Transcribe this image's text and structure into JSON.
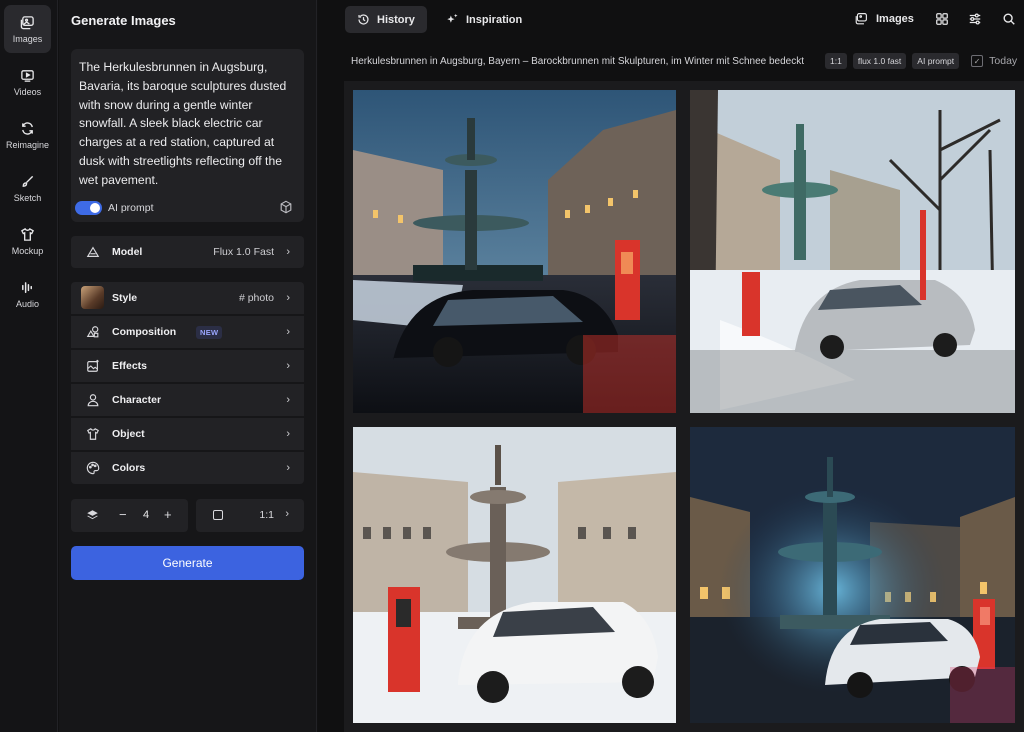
{
  "rail": {
    "items": [
      {
        "label": "Images",
        "icon": "image-icon",
        "active": true
      },
      {
        "label": "Videos",
        "icon": "video-icon"
      },
      {
        "label": "Reimagine",
        "icon": "refresh-icon"
      },
      {
        "label": "Sketch",
        "icon": "brush-icon"
      },
      {
        "label": "Mockup",
        "icon": "shirt-icon"
      },
      {
        "label": "Audio",
        "icon": "audio-wave-icon"
      }
    ]
  },
  "panel": {
    "title": "Generate Images",
    "prompt": "The Herkulesbrunnen in Augsburg, Bavaria, its baroque sculptures dusted with snow during a gentle winter snowfall. A sleek black electric car charges at a red station, captured at dusk with streetlights reflecting off the wet pavement.",
    "ai_prompt_label": "AI prompt",
    "ai_prompt_on": true,
    "model": {
      "label": "Model",
      "value": "Flux 1.0 Fast"
    },
    "settings": [
      {
        "label": "Style",
        "value": "# photo",
        "icon": "style-avatar"
      },
      {
        "label": "Composition",
        "badge": "NEW",
        "icon": "shapes-icon"
      },
      {
        "label": "Effects",
        "icon": "sparkle-image-icon"
      },
      {
        "label": "Character",
        "icon": "person-icon"
      },
      {
        "label": "Object",
        "icon": "shirt-icon"
      },
      {
        "label": "Colors",
        "icon": "palette-icon"
      }
    ],
    "count": {
      "minus": "−",
      "value": "4",
      "plus": "+"
    },
    "ratio": "1:1",
    "generate_label": "Generate"
  },
  "main": {
    "tabs": [
      {
        "label": "History",
        "icon": "history-icon",
        "active": true
      },
      {
        "label": "Inspiration",
        "icon": "sparkles-icon"
      }
    ],
    "images_label": "Images",
    "meta": {
      "prompt": "Herkulesbrunnen in Augsburg, Bayern – Barockbrunnen mit Skulpturen, im Winter mit Schnee bedeckt",
      "chips": [
        "1:1",
        "flux 1.0 fast",
        "AI prompt"
      ],
      "today_label": "Today"
    },
    "colors": {
      "accent": "#3c63e0",
      "charger_red": "#d9342b"
    }
  }
}
